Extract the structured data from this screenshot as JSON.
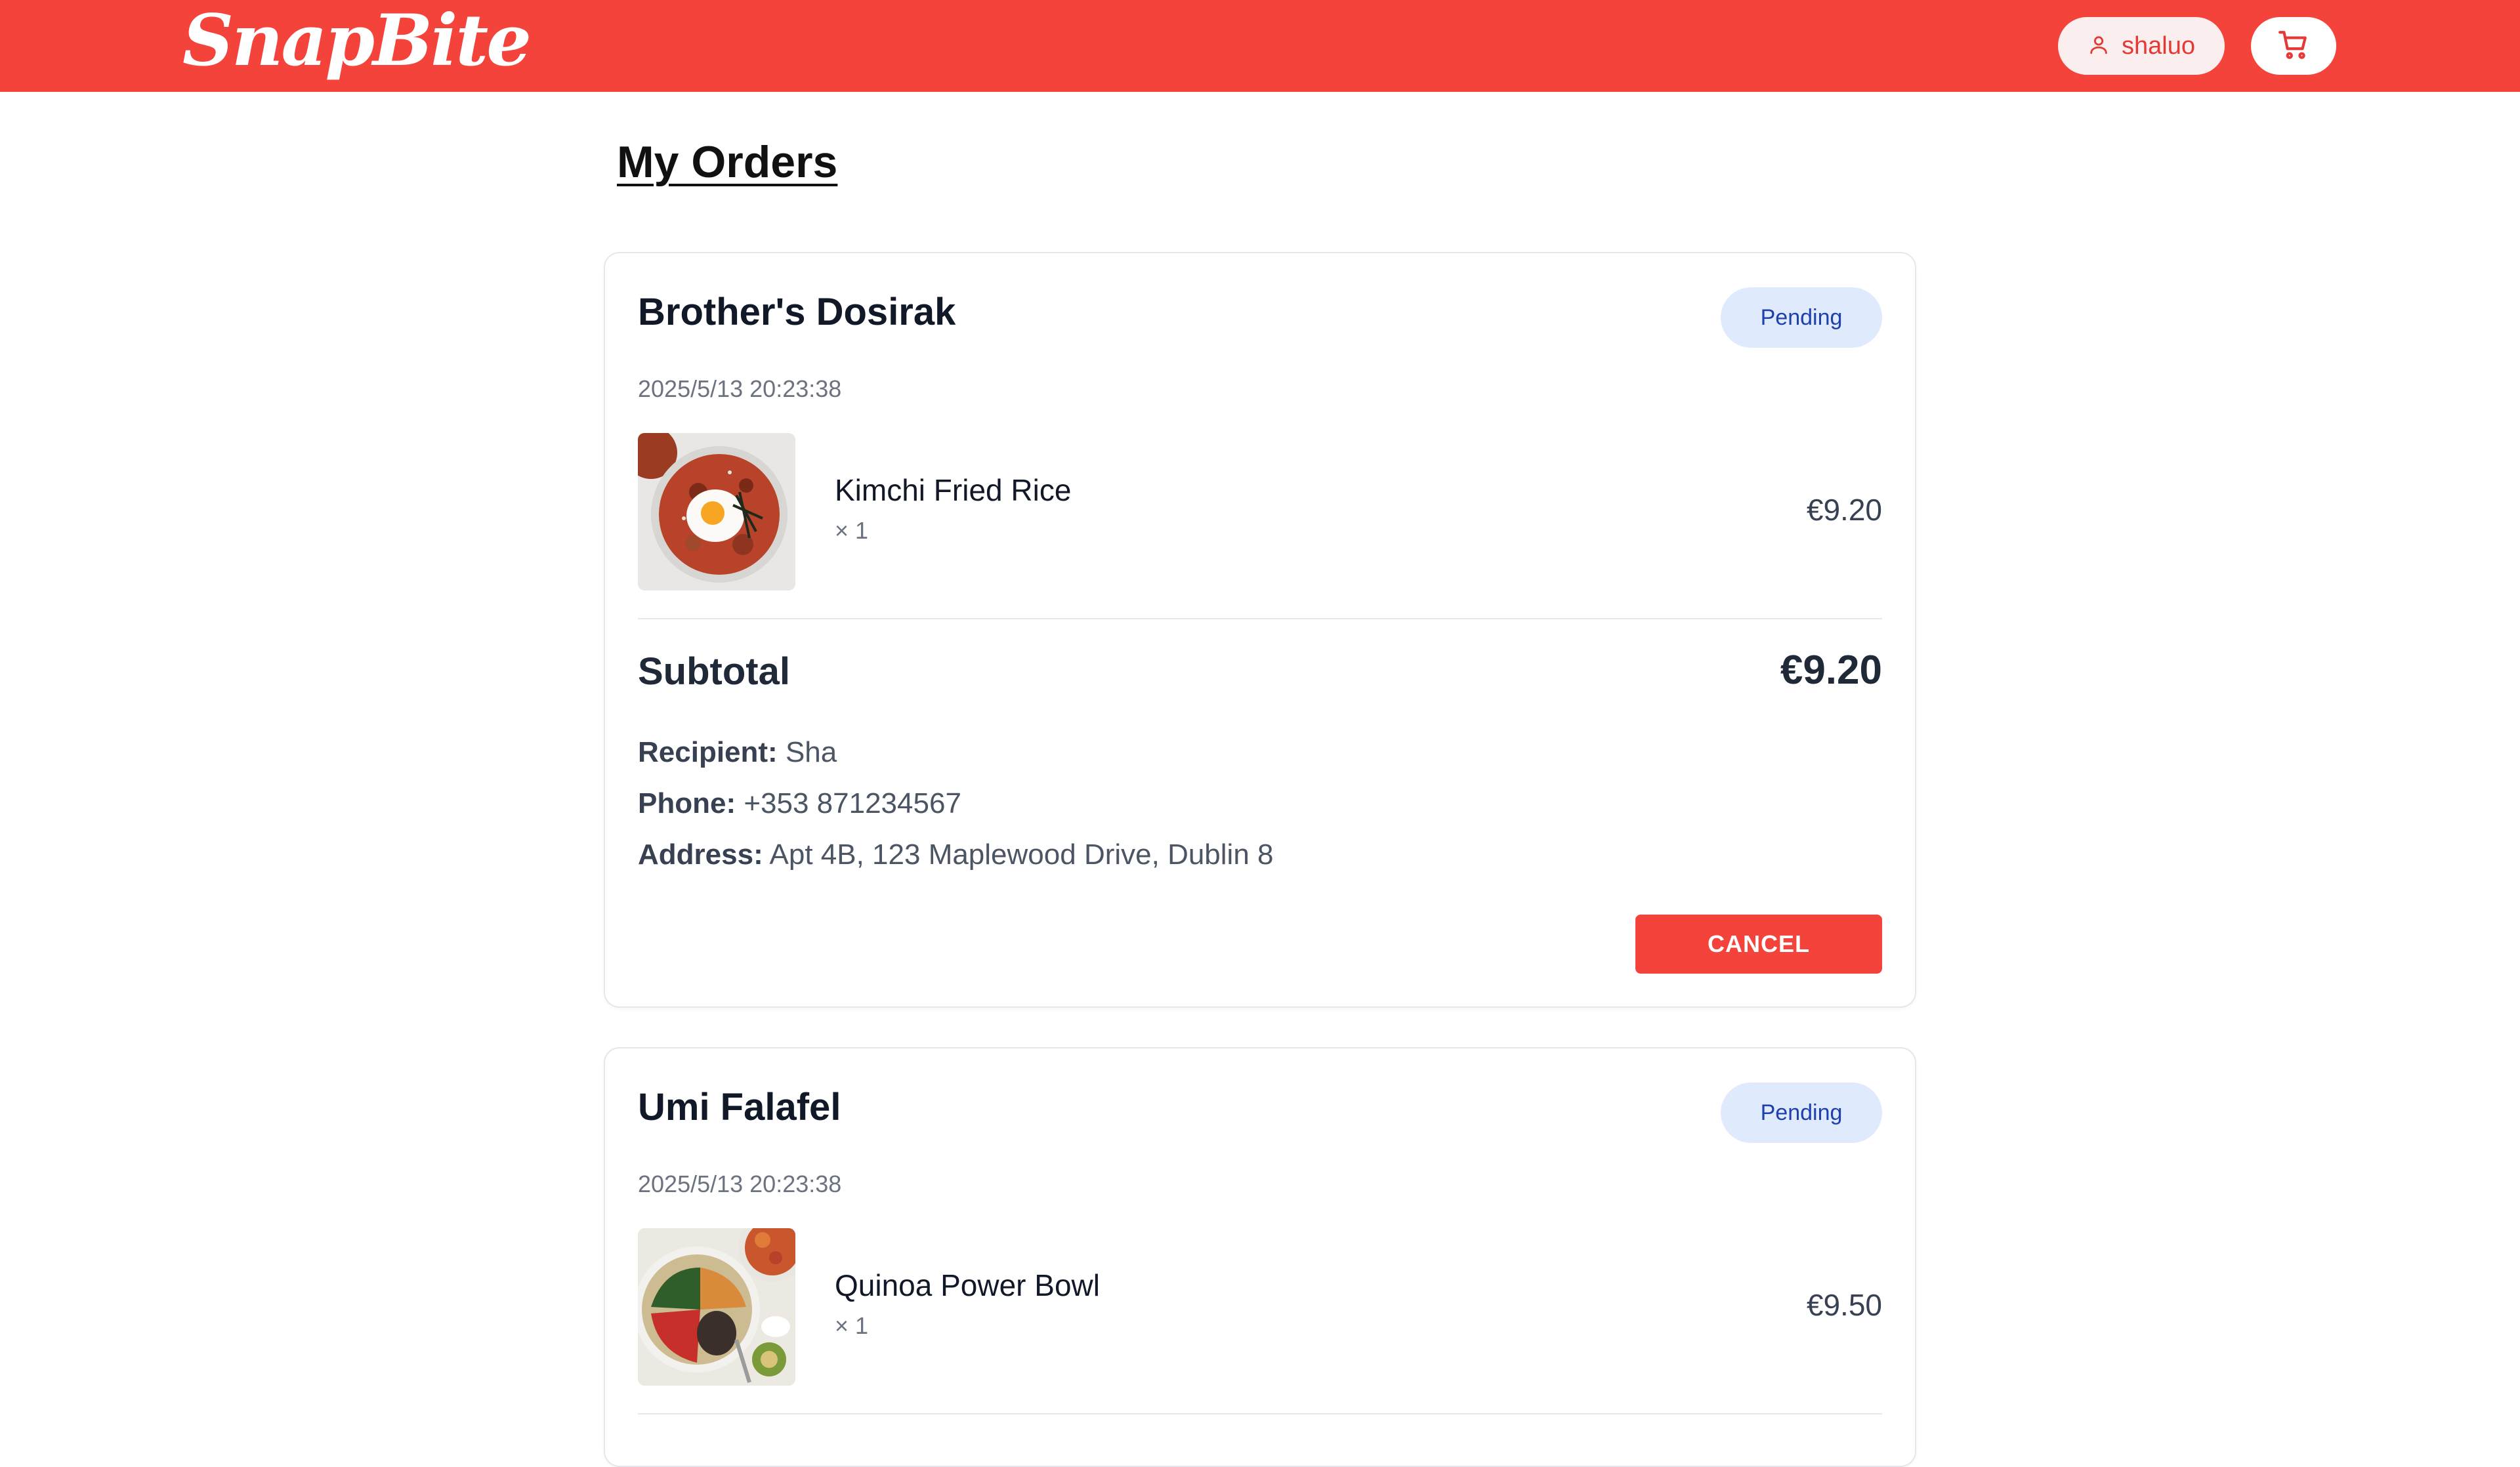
{
  "header": {
    "logo": "SnapBite",
    "username": "shaluo"
  },
  "page": {
    "title": "My Orders"
  },
  "orders": [
    {
      "restaurant": "Brother's Dosirak",
      "status": "Pending",
      "date": "2025/5/13 20:23:38",
      "items": [
        {
          "name": "Kimchi Fried Rice",
          "qty": "× 1",
          "price": "€9.20"
        }
      ],
      "subtotal_label": "Subtotal",
      "subtotal": "€9.20",
      "recipient_label": "Recipient:",
      "recipient": "Sha",
      "phone_label": "Phone:",
      "phone": "+353 871234567",
      "address_label": "Address:",
      "address": "Apt 4B, 123 Maplewood Drive, Dublin 8",
      "cancel_label": "CANCEL"
    },
    {
      "restaurant": "Umi Falafel",
      "status": "Pending",
      "date": "2025/5/13 20:23:38",
      "items": [
        {
          "name": "Quinoa Power Bowl",
          "qty": "× 1",
          "price": "€9.50"
        }
      ]
    }
  ],
  "icons": {
    "user": "user-icon",
    "cart": "cart-icon"
  },
  "colors": {
    "brand": "#f4433a",
    "badge_bg": "#dfeafd",
    "badge_text": "#1e40af"
  }
}
